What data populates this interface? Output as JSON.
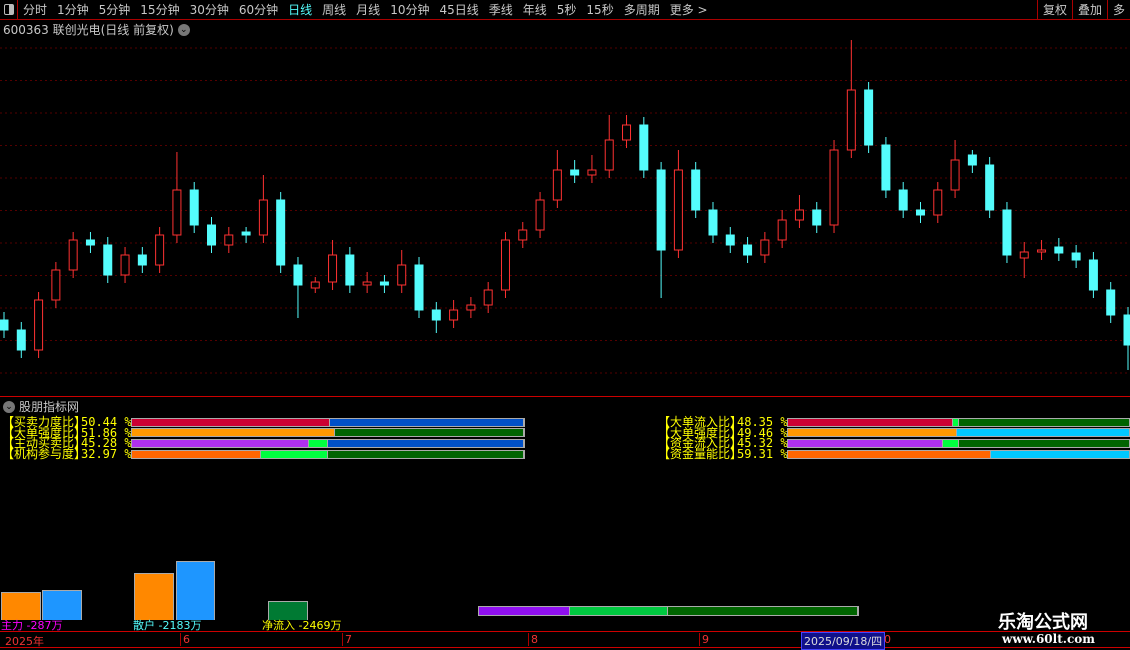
{
  "toolbar": {
    "tabs": [
      "分时",
      "1分钟",
      "5分钟",
      "15分钟",
      "30分钟",
      "60分钟",
      "日线",
      "周线",
      "月线",
      "10分钟",
      "45日线",
      "季线",
      "年线",
      "5秒",
      "15秒",
      "多周期",
      "更多 >"
    ],
    "active": "日线",
    "right": [
      "复权",
      "叠加",
      "多"
    ]
  },
  "stock": {
    "title": "600363 联创光电(日线 前复权)"
  },
  "chart_data": {
    "type": "candlestick",
    "up_color": "#ff3232",
    "down_color": "#54fcfc",
    "grid": true,
    "candles": [
      [
        8,
        8.8,
        6.2,
        7
      ],
      [
        7,
        7.8,
        4.2,
        5
      ],
      [
        5,
        10.8,
        4.2,
        10
      ],
      [
        10,
        13.8,
        9.2,
        13
      ],
      [
        13,
        16.8,
        12.2,
        16
      ],
      [
        16,
        16.8,
        14.7,
        15.5
      ],
      [
        15.5,
        16.3,
        11.7,
        12.5
      ],
      [
        12.5,
        15.3,
        11.7,
        14.5
      ],
      [
        14.5,
        15.3,
        12.7,
        13.5
      ],
      [
        13.5,
        17.3,
        12.7,
        16.5
      ],
      [
        16.5,
        24.8,
        15.7,
        21
      ],
      [
        21,
        21.8,
        16.7,
        17.5
      ],
      [
        17.5,
        18.3,
        14.7,
        15.5
      ],
      [
        15.5,
        17.3,
        14.7,
        16.5
      ],
      [
        16.8,
        17.3,
        15.7,
        16.5
      ],
      [
        16.5,
        22.5,
        15.7,
        20
      ],
      [
        20,
        20.8,
        12.7,
        13.5
      ],
      [
        13.5,
        14.3,
        8.2,
        11.5
      ],
      [
        11.2,
        12.3,
        10.7,
        11.8
      ],
      [
        11.8,
        16,
        11,
        14.5
      ],
      [
        14.5,
        15.3,
        10.7,
        11.5
      ],
      [
        11.5,
        12.8,
        10.7,
        11.8
      ],
      [
        11.8,
        12.5,
        10.7,
        11.5
      ],
      [
        11.5,
        15,
        10.7,
        13.5
      ],
      [
        13.5,
        14.3,
        8.2,
        9
      ],
      [
        9,
        9.8,
        6.7,
        8
      ],
      [
        8,
        10,
        7.2,
        9
      ],
      [
        9,
        10.3,
        8.2,
        9.5
      ],
      [
        9.5,
        11.8,
        8.7,
        11
      ],
      [
        11,
        16.8,
        10.2,
        16
      ],
      [
        16,
        17.8,
        15.2,
        17
      ],
      [
        17,
        20.8,
        16.2,
        20
      ],
      [
        20,
        25,
        19.2,
        23
      ],
      [
        23,
        24,
        21.7,
        22.5
      ],
      [
        22.5,
        24.5,
        21.7,
        23
      ],
      [
        23,
        28.5,
        22.2,
        26
      ],
      [
        26,
        28.5,
        25.2,
        27.5
      ],
      [
        27.5,
        28.3,
        22.2,
        23
      ],
      [
        23,
        23.8,
        10.2,
        15
      ],
      [
        15,
        25,
        14.2,
        23
      ],
      [
        23,
        23.8,
        18.2,
        19
      ],
      [
        19,
        19.8,
        15.7,
        16.5
      ],
      [
        16.5,
        17.3,
        14.7,
        15.5
      ],
      [
        15.5,
        16.3,
        13.7,
        14.5
      ],
      [
        14.5,
        16.8,
        13.7,
        16
      ],
      [
        16,
        19,
        15.2,
        18
      ],
      [
        18,
        20.5,
        17.2,
        19
      ],
      [
        19,
        19.8,
        16.7,
        17.5
      ],
      [
        17.5,
        26,
        16.7,
        25
      ],
      [
        25,
        36,
        24.2,
        31
      ],
      [
        31,
        31.8,
        24.7,
        25.5
      ],
      [
        25.5,
        26.3,
        20.2,
        21
      ],
      [
        21,
        21.8,
        18.2,
        19
      ],
      [
        19,
        19.8,
        17.7,
        18.5
      ],
      [
        18.5,
        21.8,
        17.7,
        21
      ],
      [
        21,
        26,
        20.2,
        24
      ],
      [
        24.5,
        25,
        22.7,
        23.5
      ],
      [
        23.5,
        24.3,
        18.2,
        19
      ],
      [
        19,
        19.8,
        13.7,
        14.5
      ],
      [
        14.2,
        15.8,
        12.2,
        14.8
      ],
      [
        14.8,
        16,
        14,
        15
      ],
      [
        15.3,
        16.2,
        13.9,
        14.7
      ],
      [
        14.7,
        15.5,
        13.2,
        14
      ],
      [
        14,
        14.8,
        10.2,
        11
      ],
      [
        11,
        11.8,
        7.7,
        8.5
      ],
      [
        8.5,
        9.3,
        3,
        5.5
      ]
    ]
  },
  "indicator": {
    "title": "股朋指标网",
    "left": [
      {
        "label": "【买卖力度比】",
        "value": "50.44 %",
        "segments": [
          {
            "f": 0.5044,
            "c": "#cc0033"
          },
          {
            "f": 0.4956,
            "c": "#0050c8"
          }
        ]
      },
      {
        "label": "【大单强度比】",
        "value": "51.86 %",
        "segments": [
          {
            "f": 0.5186,
            "c": "#ff9900"
          },
          {
            "f": 0.4814,
            "c": "#006400"
          }
        ]
      },
      {
        "label": "【主动买卖比】",
        "value": "45.28 %",
        "segments": [
          {
            "f": 0.4528,
            "c": "#b030f0"
          },
          {
            "f": 0.047,
            "c": "#00ff40"
          },
          {
            "f": 0.5002,
            "c": "#0050c8"
          }
        ]
      },
      {
        "label": "【机构参与度】",
        "value": "32.97 %",
        "segments": [
          {
            "f": 0.3297,
            "c": "#ff6600"
          },
          {
            "f": 0.17,
            "c": "#00ff40"
          },
          {
            "f": 0.5003,
            "c": "#006400"
          }
        ]
      }
    ],
    "right": [
      {
        "label": "【大单流入比】",
        "value": "48.35 %",
        "segments": [
          {
            "f": 0.4835,
            "c": "#cc0033"
          },
          {
            "f": 0.0165,
            "c": "#00ff40"
          },
          {
            "f": 0.5,
            "c": "#006400"
          }
        ]
      },
      {
        "label": "【大单强度比】",
        "value": "49.46 %",
        "segments": [
          {
            "f": 0.4946,
            "c": "#ff9900"
          },
          {
            "f": 0.5054,
            "c": "#00c8ff"
          }
        ]
      },
      {
        "label": "【资金流入比】",
        "value": "45.32 %",
        "segments": [
          {
            "f": 0.4532,
            "c": "#b030f0"
          },
          {
            "f": 0.0468,
            "c": "#00ff40"
          },
          {
            "f": 0.5,
            "c": "#006400"
          }
        ]
      },
      {
        "label": "【资金量能比】",
        "value": "59.31 %",
        "segments": [
          {
            "f": 0.5931,
            "c": "#ff6600"
          },
          {
            "f": 0.4069,
            "c": "#00c8ff"
          }
        ]
      }
    ],
    "flows": {
      "main": "主力 -287万",
      "retail": "散户 -2183万",
      "net": "净流入 -2469万"
    },
    "bottom_bar": [
      {
        "f": 0.24,
        "c": "#9010f0"
      },
      {
        "f": 0.26,
        "c": "#00c840"
      },
      {
        "f": 0.5,
        "c": "#006400"
      }
    ]
  },
  "axis": {
    "labels": [
      "2025年",
      "6",
      "7",
      "8",
      "9"
    ],
    "cursor_date": "2025/09/18/四",
    "after": "0"
  },
  "watermark": {
    "name": "乐淘公式网",
    "url": "www.60lt.com"
  }
}
